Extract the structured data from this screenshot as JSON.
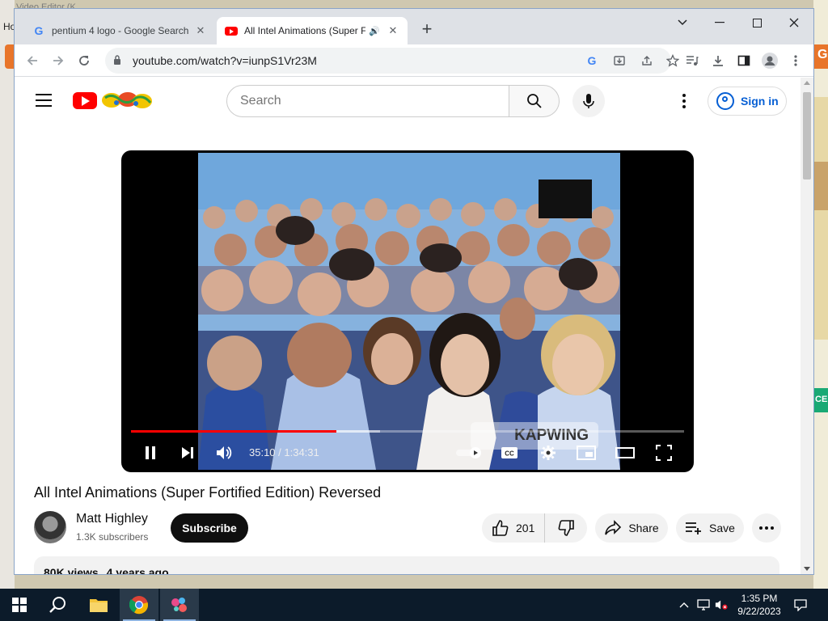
{
  "desktop": {
    "top_text": "Video Editor (K...",
    "ho_label": "Ho",
    "right_badge": "G",
    "right_green": "CE"
  },
  "browser": {
    "tabs": [
      {
        "title": "pentium 4 logo - Google Search",
        "favicon": "google-icon",
        "active": false
      },
      {
        "title": "All Intel Animations (Super F",
        "favicon": "youtube-icon",
        "active": true,
        "audio": true
      }
    ],
    "new_tab": "+",
    "url": "youtube.com/watch?v=iunpS1Vr23M"
  },
  "youtube": {
    "search_placeholder": "Search",
    "sign_in": "Sign in",
    "player": {
      "current_time": "35:10",
      "duration": "1:34:31",
      "time_display": "35:10 / 1:34:31",
      "progress_fraction": 0.372,
      "buffered_fraction": 0.45,
      "watermark": "KAPWING"
    },
    "video_title": "All Intel Animations (Super Fortified Edition) Reversed",
    "channel": {
      "name": "Matt Highley",
      "subscribers": "1.3K subscribers"
    },
    "subscribe_label": "Subscribe",
    "likes": "201",
    "share_label": "Share",
    "save_label": "Save",
    "views": "80K views",
    "uploaded": "4 years ago"
  },
  "taskbar": {
    "time": "1:35 PM",
    "date": "9/22/2023"
  },
  "colors": {
    "youtube_red": "#ff0000",
    "link_blue": "#065fd4",
    "taskbar": "#0c1b2a"
  }
}
